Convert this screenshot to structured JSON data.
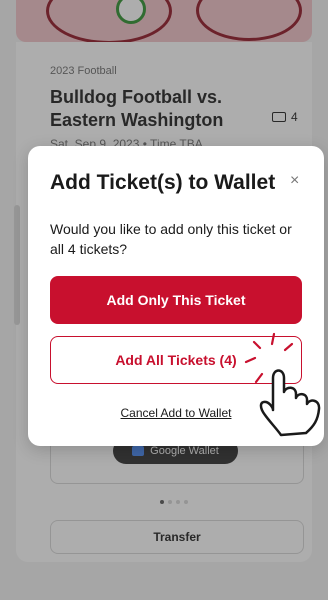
{
  "background": {
    "season": "2023 Football",
    "event_title": "Bulldog Football vs. Eastern Washington",
    "ticket_count": "4",
    "event_date": "Sat, Sep 9, 2023 • Time TBA",
    "google_wallet_label": "Google Wallet",
    "transfer_label": "Transfer"
  },
  "modal": {
    "title": "Add Ticket(s) to Wallet",
    "close_symbol": "×",
    "body": "Would you like to add only this ticket or all 4 tickets?",
    "add_only_label": "Add Only This Ticket",
    "add_all_label": "Add All Tickets (4)",
    "cancel_label": "Cancel Add to Wallet"
  },
  "colors": {
    "accent": "#c8102e"
  }
}
